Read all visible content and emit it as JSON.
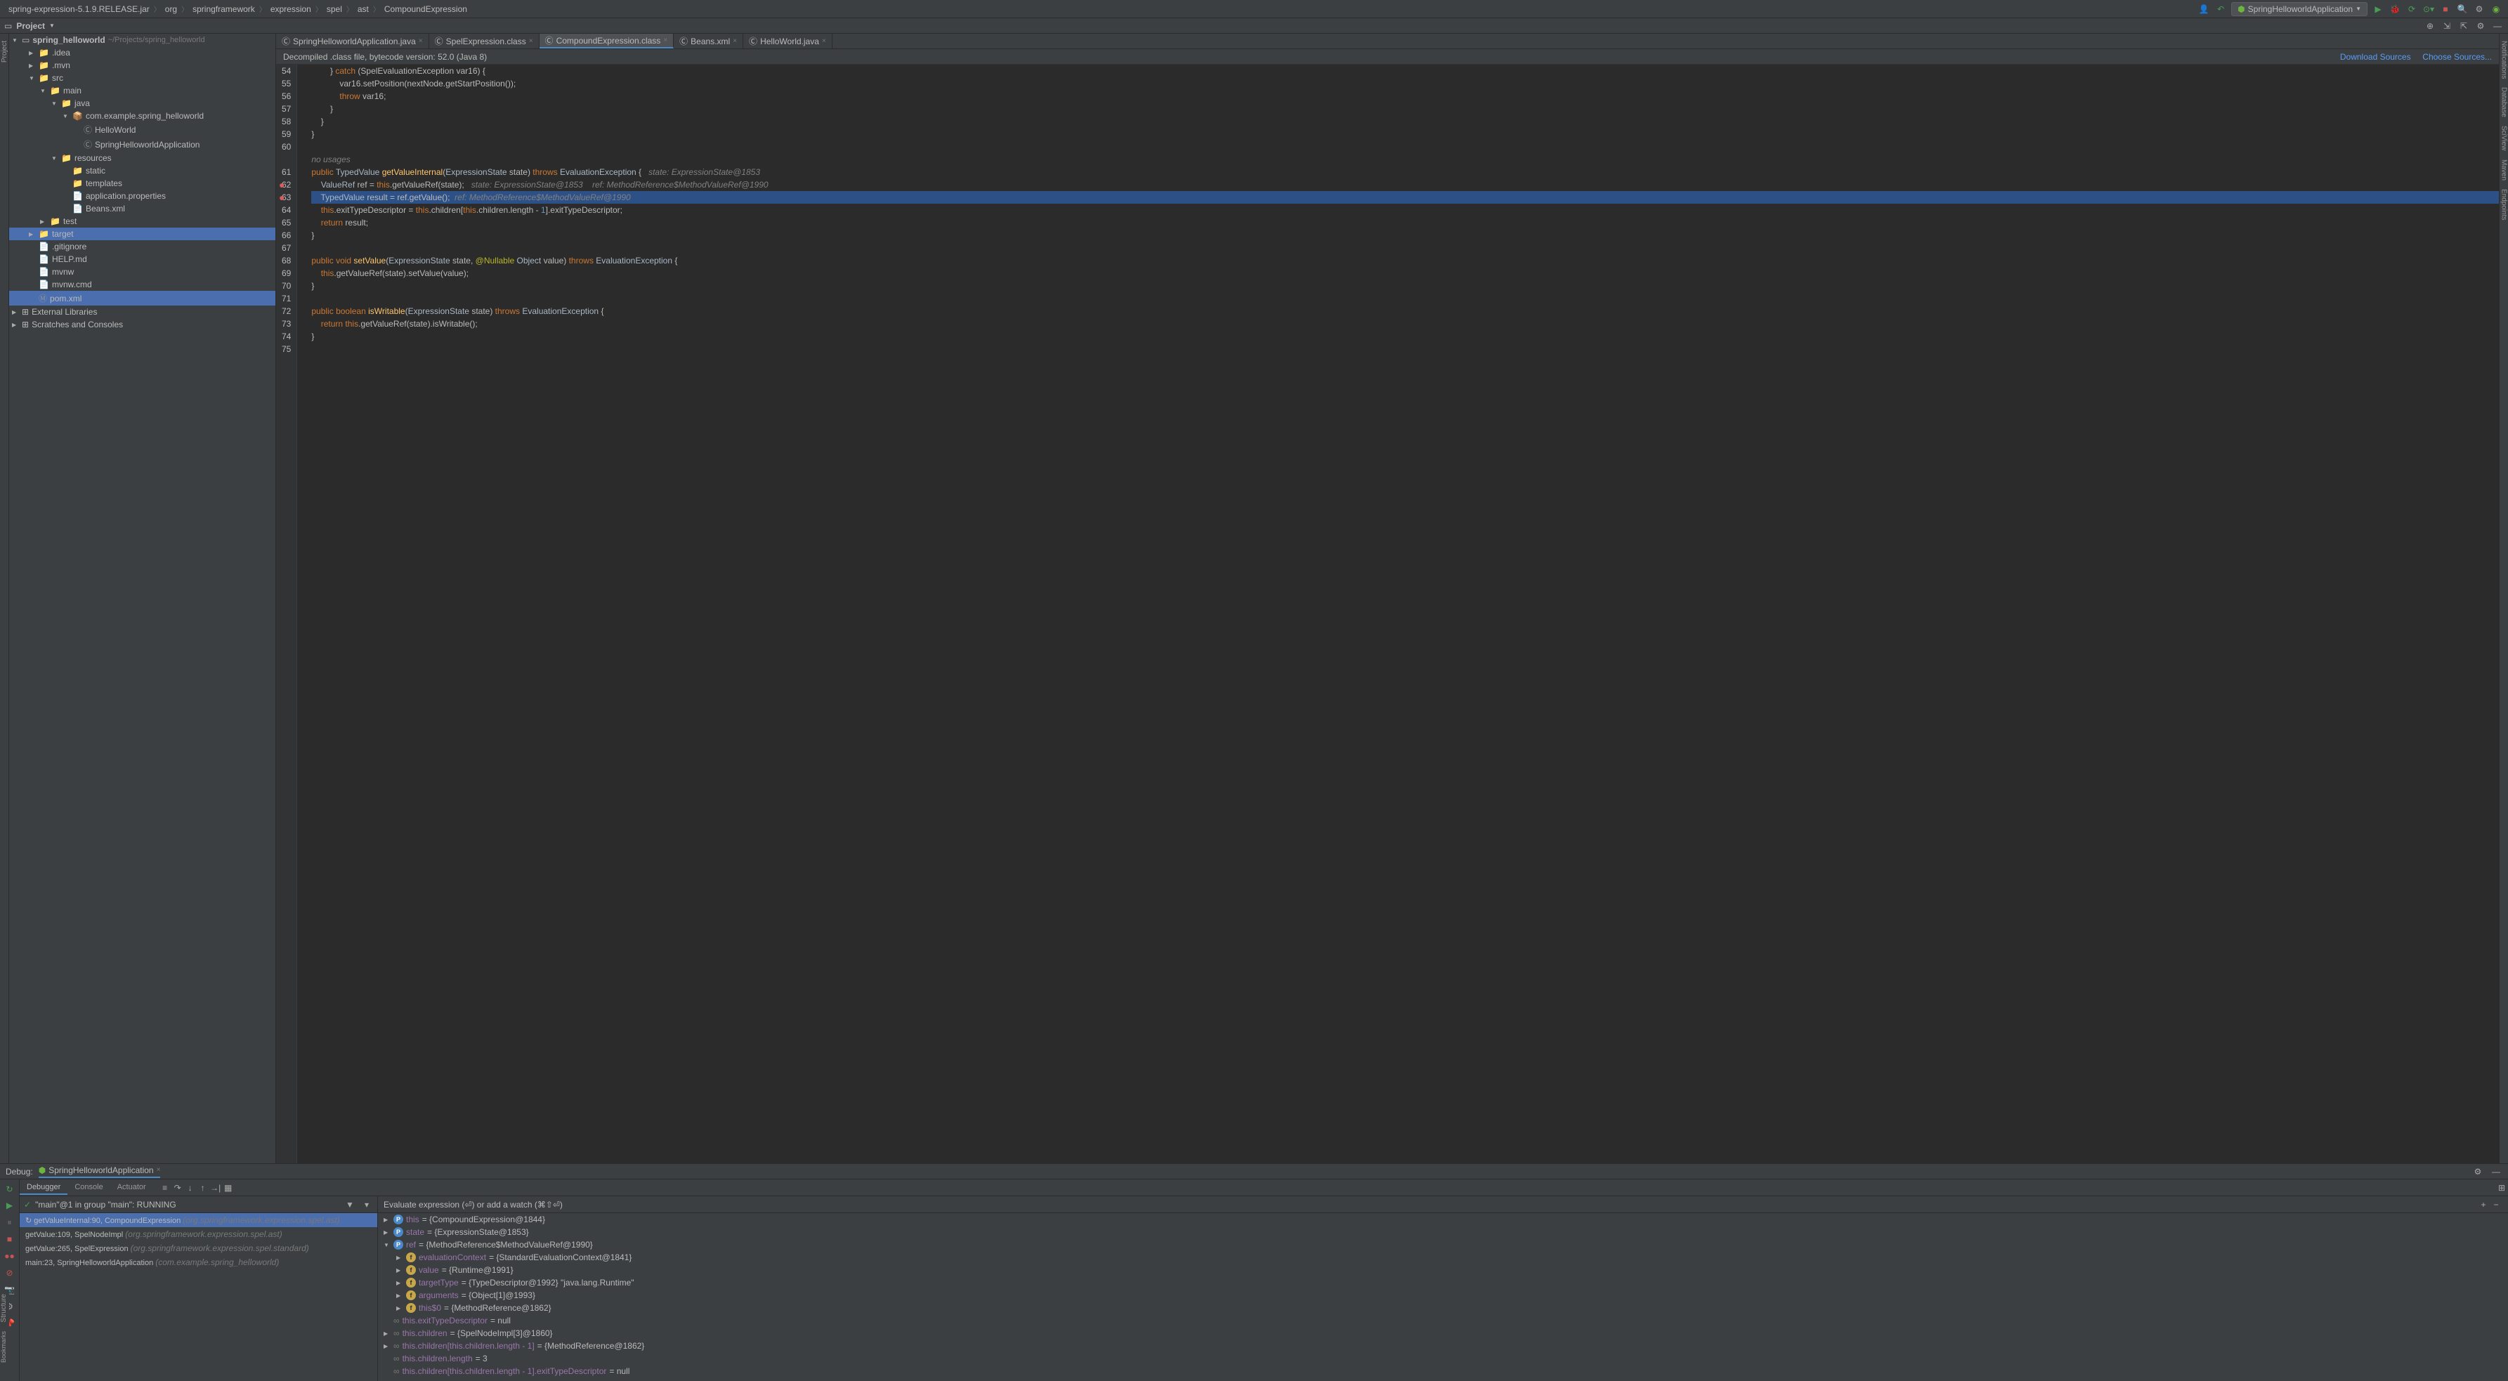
{
  "breadcrumb": [
    "spring-expression-5.1.9.RELEASE.jar",
    "org",
    "springframework",
    "expression",
    "spel",
    "ast",
    "CompoundExpression"
  ],
  "run_config": "SpringHelloworldApplication",
  "project_header": "Project",
  "tree": {
    "root": "spring_helloworld",
    "root_path": "~/Projects/spring_helloworld",
    "items": [
      {
        "level": 1,
        "label": ".idea",
        "icon": "folder",
        "arrow": "▶"
      },
      {
        "level": 1,
        "label": ".mvn",
        "icon": "folder",
        "arrow": "▶"
      },
      {
        "level": 1,
        "label": "src",
        "icon": "folder",
        "arrow": "▼"
      },
      {
        "level": 2,
        "label": "main",
        "icon": "folder",
        "arrow": "▼"
      },
      {
        "level": 3,
        "label": "java",
        "icon": "folder",
        "arrow": "▼"
      },
      {
        "level": 4,
        "label": "com.example.spring_helloworld",
        "icon": "package",
        "arrow": "▼"
      },
      {
        "level": 5,
        "label": "HelloWorld",
        "icon": "class",
        "arrow": ""
      },
      {
        "level": 5,
        "label": "SpringHelloworldApplication",
        "icon": "class",
        "arrow": ""
      },
      {
        "level": 3,
        "label": "resources",
        "icon": "folder",
        "arrow": "▼"
      },
      {
        "level": 4,
        "label": "static",
        "icon": "folder",
        "arrow": ""
      },
      {
        "level": 4,
        "label": "templates",
        "icon": "folder",
        "arrow": ""
      },
      {
        "level": 4,
        "label": "application.properties",
        "icon": "file",
        "arrow": ""
      },
      {
        "level": 4,
        "label": "Beans.xml",
        "icon": "xml",
        "arrow": ""
      },
      {
        "level": 2,
        "label": "test",
        "icon": "folder",
        "arrow": "▶"
      },
      {
        "level": 1,
        "label": "target",
        "icon": "folder",
        "arrow": "▶",
        "selected": true
      },
      {
        "level": 1,
        "label": ".gitignore",
        "icon": "file",
        "arrow": ""
      },
      {
        "level": 1,
        "label": "HELP.md",
        "icon": "md",
        "arrow": ""
      },
      {
        "level": 1,
        "label": "mvnw",
        "icon": "file",
        "arrow": ""
      },
      {
        "level": 1,
        "label": "mvnw.cmd",
        "icon": "file",
        "arrow": ""
      },
      {
        "level": 1,
        "label": "pom.xml",
        "icon": "maven",
        "arrow": "",
        "selected": true
      }
    ],
    "external_lib": "External Libraries",
    "scratches": "Scratches and Consoles"
  },
  "tabs": [
    {
      "label": "SpringHelloworldApplication.java",
      "active": false
    },
    {
      "label": "SpelExpression.class",
      "active": false
    },
    {
      "label": "CompoundExpression.class",
      "active": true
    },
    {
      "label": "Beans.xml",
      "active": false
    },
    {
      "label": "HelloWorld.java",
      "active": false
    }
  ],
  "decompile_msg": "Decompiled .class file, bytecode version: 52.0 (Java 8)",
  "download_sources": "Download Sources",
  "choose_sources": "Choose Sources...",
  "code_lines": [
    {
      "n": 54,
      "html": "        } <span class='kw'>catch</span> (SpelEvaluationException var16) {"
    },
    {
      "n": 55,
      "html": "            var16.setPosition(nextNode.getStartPosition());"
    },
    {
      "n": 56,
      "html": "            <span class='kw'>throw</span> var16;"
    },
    {
      "n": 57,
      "html": "        }"
    },
    {
      "n": 58,
      "html": "    }"
    },
    {
      "n": 59,
      "html": "}"
    },
    {
      "n": 60,
      "html": ""
    },
    {
      "n": "",
      "html": "<span class='comment'>no usages</span>"
    },
    {
      "n": 61,
      "html": "<span class='kw'>public</span> <span class='type'>TypedValue</span> <span class='fn'>getValueInternal</span>(<span class='type'>ExpressionState</span> state) <span class='kw'>throws</span> <span class='type'>EvaluationException</span> {   <span class='comment'>state: ExpressionState@1853</span>"
    },
    {
      "n": 62,
      "bp": true,
      "html": "    <span class='type'>ValueRef</span> ref = <span class='kw'>this</span>.getValueRef(state);   <span class='comment'>state: ExpressionState@1853    ref: MethodReference$MethodValueRef@1990</span>"
    },
    {
      "n": 63,
      "bp": true,
      "current": true,
      "html": "    <span class='type'>TypedValue</span> result = ref.getValue();  <span class='comment'>ref: MethodReference$MethodValueRef@1990</span>"
    },
    {
      "n": 64,
      "html": "    <span class='kw'>this</span>.exitTypeDescriptor = <span class='kw'>this</span>.children[<span class='kw'>this</span>.children.length - <span class='num'>1</span>].exitTypeDescriptor;"
    },
    {
      "n": 65,
      "html": "    <span class='kw'>return</span> result;"
    },
    {
      "n": 66,
      "html": "}"
    },
    {
      "n": 67,
      "html": ""
    },
    {
      "n": 68,
      "html": "<span class='kw'>public</span> <span class='kw'>void</span> <span class='fn'>setValue</span>(<span class='type'>ExpressionState</span> state, <span class='anno'>@Nullable</span> <span class='type'>Object</span> value) <span class='kw'>throws</span> <span class='type'>EvaluationException</span> {"
    },
    {
      "n": 69,
      "html": "    <span class='kw'>this</span>.getValueRef(state).setValue(value);"
    },
    {
      "n": 70,
      "html": "}"
    },
    {
      "n": 71,
      "html": ""
    },
    {
      "n": 72,
      "html": "<span class='kw'>public</span> <span class='kw'>boolean</span> <span class='fn'>isWritable</span>(<span class='type'>ExpressionState</span> state) <span class='kw'>throws</span> <span class='type'>EvaluationException</span> {"
    },
    {
      "n": 73,
      "html": "    <span class='kw'>return</span> <span class='kw'>this</span>.getValueRef(state).isWritable();"
    },
    {
      "n": 74,
      "html": "}"
    },
    {
      "n": 75,
      "html": ""
    }
  ],
  "debug": {
    "title": "Debug:",
    "config": "SpringHelloworldApplication",
    "tabs": [
      "Debugger",
      "Console",
      "Actuator"
    ],
    "thread": "\"main\"@1 in group \"main\": RUNNING",
    "frames": [
      {
        "text": "getValueInternal:90, CompoundExpression",
        "loc": "(org.springframework.expression.spel.ast)",
        "selected": true
      },
      {
        "text": "getValue:109, SpelNodeImpl",
        "loc": "(org.springframework.expression.spel.ast)"
      },
      {
        "text": "getValue:265, SpelExpression",
        "loc": "(org.springframework.expression.spel.standard)"
      },
      {
        "text": "main:23, SpringHelloworldApplication",
        "loc": "(com.example.spring_helloworld)"
      }
    ],
    "watch_placeholder": "Evaluate expression (⏎) or add a watch (⌘⇧⏎)",
    "vars": [
      {
        "indent": 0,
        "arrow": "▶",
        "icon": "p",
        "name": "this",
        "val": "= {CompoundExpression@1844}"
      },
      {
        "indent": 0,
        "arrow": "▶",
        "icon": "p",
        "name": "state",
        "val": "= {ExpressionState@1853}"
      },
      {
        "indent": 0,
        "arrow": "▼",
        "icon": "p",
        "name": "ref",
        "val": "= {MethodReference$MethodValueRef@1990}"
      },
      {
        "indent": 1,
        "arrow": "▶",
        "icon": "f",
        "name": "evaluationContext",
        "val": "= {StandardEvaluationContext@1841}"
      },
      {
        "indent": 1,
        "arrow": "▶",
        "icon": "f",
        "name": "value",
        "val": "= {Runtime@1991}"
      },
      {
        "indent": 1,
        "arrow": "▶",
        "icon": "f",
        "name": "targetType",
        "val": "= {TypeDescriptor@1992} \"java.lang.Runtime\""
      },
      {
        "indent": 1,
        "arrow": "▶",
        "icon": "f",
        "name": "arguments",
        "val": "= {Object[1]@1993}"
      },
      {
        "indent": 1,
        "arrow": "▶",
        "icon": "f",
        "name": "this$0",
        "val": "= {MethodReference@1862}"
      },
      {
        "indent": 0,
        "arrow": "",
        "icon": "oo",
        "name": "this.exitTypeDescriptor",
        "val": "= null"
      },
      {
        "indent": 0,
        "arrow": "▶",
        "icon": "oo",
        "name": "this.children",
        "val": "= {SpelNodeImpl[3]@1860}"
      },
      {
        "indent": 0,
        "arrow": "▶",
        "icon": "oo",
        "name": "this.children[this.children.length - 1]",
        "val": "= {MethodReference@1862}"
      },
      {
        "indent": 0,
        "arrow": "",
        "icon": "oo",
        "name": "this.children.length",
        "val": "= 3"
      },
      {
        "indent": 0,
        "arrow": "",
        "icon": "oo",
        "name": "this.children[this.children.length - 1].exitTypeDescriptor",
        "val": "= null"
      }
    ]
  },
  "right_tools": [
    "Notifications",
    "Database",
    "SciView",
    "Maven",
    "Endpoints"
  ],
  "left_tools": [
    "Project",
    "Bookmarks",
    "Structure"
  ]
}
